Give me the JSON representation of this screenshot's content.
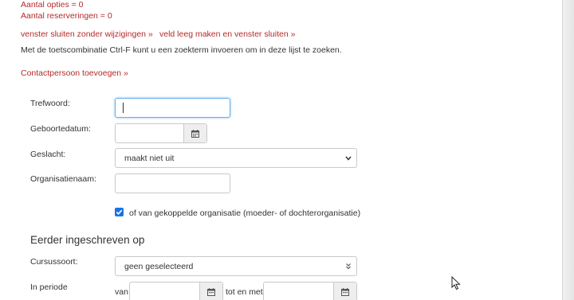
{
  "counters": {
    "options": "Aantal opties = 0",
    "reservations": "Aantal reserveringen = 0"
  },
  "actions": {
    "close_no_changes": "venster sluiten zonder wijzigingen »",
    "clear_and_close": "veld leeg maken en venster sluiten »"
  },
  "hint": "Met de toetscombinatie Ctrl-F kunt u een zoekterm invoeren om in deze lijst te zoeken.",
  "add_contact": "Contactpersoon toevoegen »",
  "form": {
    "keyword_label": "Trefwoord:",
    "keyword_value": "",
    "birthdate_label": "Geboortedatum:",
    "birthdate_value": "",
    "gender_label": "Geslacht:",
    "gender_value": "maakt niet uit",
    "org_label": "Organisatienaam:",
    "org_value": "",
    "linked_org_label": "of van gekoppelde organisatie (moeder- of dochterorganisatie)",
    "linked_org_checked": true
  },
  "previous": {
    "title": "Eerder ingeschreven op",
    "course_type_label": "Cursussoort:",
    "course_type_value": "geen geselecteerd",
    "period_label": "In periode",
    "from_label": "van",
    "to_label": "tot en met"
  },
  "colors": {
    "link": "#b52a2a",
    "checkbox": "#1a73e8",
    "focus": "#66afe9"
  },
  "icons": {
    "calendar": "calendar-icon",
    "dropdown": "chevron-down-icon",
    "double_chevron": "double-chevron-icon",
    "check": "check-icon",
    "pointer": "mouse-pointer-icon"
  }
}
